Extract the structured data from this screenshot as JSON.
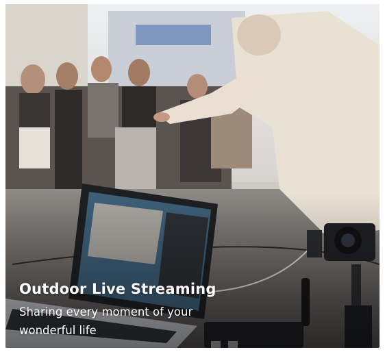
{
  "card": {
    "title": "Outdoor Live Streaming",
    "subtitle_line1": "Sharing every moment of your",
    "subtitle_line2": "wonderful life"
  },
  "colors": {
    "text": "#ffffff",
    "sky": "#e9ecef",
    "street": "#6f6b68",
    "crowd": "#4b4643",
    "jacket": "#e8ddd0"
  },
  "icons": [
    "laptop-icon",
    "camera-gimbal-icon",
    "transmitter-icon"
  ]
}
